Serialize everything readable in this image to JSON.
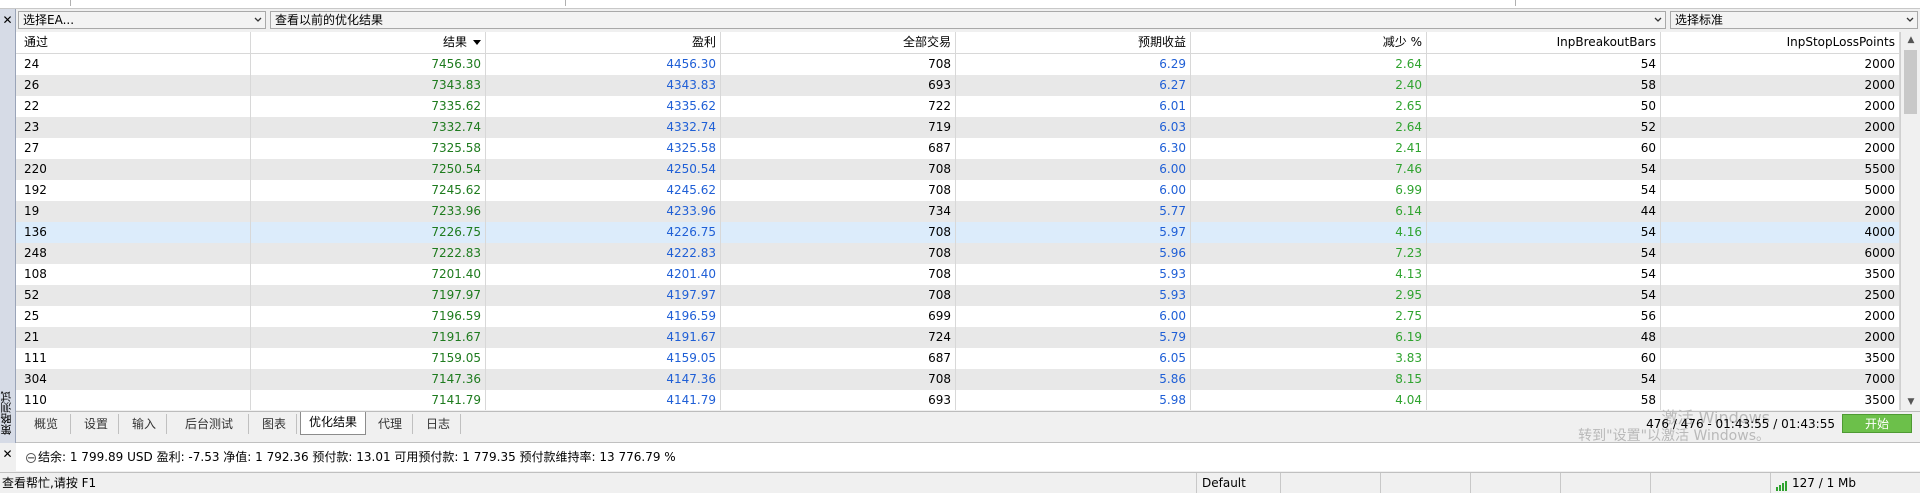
{
  "selectors": {
    "ea": "选择EA...",
    "results": "查看以前的优化结果",
    "criterion": "选择标准"
  },
  "grid": {
    "headers": [
      "通过",
      "结果",
      "盈利",
      "全部交易",
      "预期收益",
      "减少 %",
      "InpBreakoutBars",
      "InpStopLossPoints"
    ],
    "sorted_column": "结果",
    "rows": [
      [
        "24",
        "7456.30",
        "4456.30",
        "708",
        "6.29",
        "2.64",
        "54",
        "2000"
      ],
      [
        "26",
        "7343.83",
        "4343.83",
        "693",
        "6.27",
        "2.40",
        "58",
        "2000"
      ],
      [
        "22",
        "7335.62",
        "4335.62",
        "722",
        "6.01",
        "2.65",
        "50",
        "2000"
      ],
      [
        "23",
        "7332.74",
        "4332.74",
        "719",
        "6.03",
        "2.64",
        "52",
        "2000"
      ],
      [
        "27",
        "7325.58",
        "4325.58",
        "687",
        "6.30",
        "2.41",
        "60",
        "2000"
      ],
      [
        "220",
        "7250.54",
        "4250.54",
        "708",
        "6.00",
        "7.46",
        "54",
        "5500"
      ],
      [
        "192",
        "7245.62",
        "4245.62",
        "708",
        "6.00",
        "6.99",
        "54",
        "5000"
      ],
      [
        "19",
        "7233.96",
        "4233.96",
        "734",
        "5.77",
        "6.14",
        "44",
        "2000"
      ],
      [
        "136",
        "7226.75",
        "4226.75",
        "708",
        "5.97",
        "4.16",
        "54",
        "4000"
      ],
      [
        "248",
        "7222.83",
        "4222.83",
        "708",
        "5.96",
        "7.23",
        "54",
        "6000"
      ],
      [
        "108",
        "7201.40",
        "4201.40",
        "708",
        "5.93",
        "4.13",
        "54",
        "3500"
      ],
      [
        "52",
        "7197.97",
        "4197.97",
        "708",
        "5.93",
        "2.95",
        "54",
        "2500"
      ],
      [
        "25",
        "7196.59",
        "4196.59",
        "699",
        "6.00",
        "2.75",
        "56",
        "2000"
      ],
      [
        "21",
        "7191.67",
        "4191.67",
        "724",
        "5.79",
        "6.19",
        "48",
        "2000"
      ],
      [
        "111",
        "7159.05",
        "4159.05",
        "687",
        "6.05",
        "3.83",
        "60",
        "3500"
      ],
      [
        "304",
        "7147.36",
        "4147.36",
        "708",
        "5.86",
        "8.15",
        "54",
        "7000"
      ],
      [
        "110",
        "7141.79",
        "4141.79",
        "693",
        "5.98",
        "4.04",
        "58",
        "3500"
      ]
    ],
    "selected_row_index": 8
  },
  "tabs": [
    {
      "label": "概览",
      "active": false
    },
    {
      "label": "设置",
      "active": false
    },
    {
      "label": "输入",
      "active": false
    },
    {
      "label": "后台测试",
      "active": false
    },
    {
      "label": "图表",
      "active": false
    },
    {
      "label": "优化结果",
      "active": true
    },
    {
      "label": "代理",
      "active": false
    },
    {
      "label": "日志",
      "active": false
    }
  ],
  "progress": {
    "text": "476 / 476  -  01:43:55 / 01:43:55",
    "start_label": "开始"
  },
  "watermark": {
    "line1": "激活 Windows",
    "line2": "转到\"设置\"以激活 Windows。"
  },
  "balance": {
    "text": "结余: 1 799.89 USD  盈利: -7.53  净值: 1 792.36  预付款: 13.01  可用预付款: 1 779.35  预付款维持率: 13 776.79 %"
  },
  "sidebar": {
    "title": "策略测试"
  },
  "statusbar": {
    "help": "查看帮忙,请按 F1",
    "profile": "Default",
    "connection": "127 / 1 Mb"
  },
  "colors": {
    "result": "#1e7b1e",
    "profit": "#1f5fd6",
    "expected": "#1f5fd6",
    "drawdown": "#2fa32f",
    "start_button": "#6cc04a",
    "selected_row": "#dcecfb",
    "alt_row": "#e8e8e8"
  }
}
